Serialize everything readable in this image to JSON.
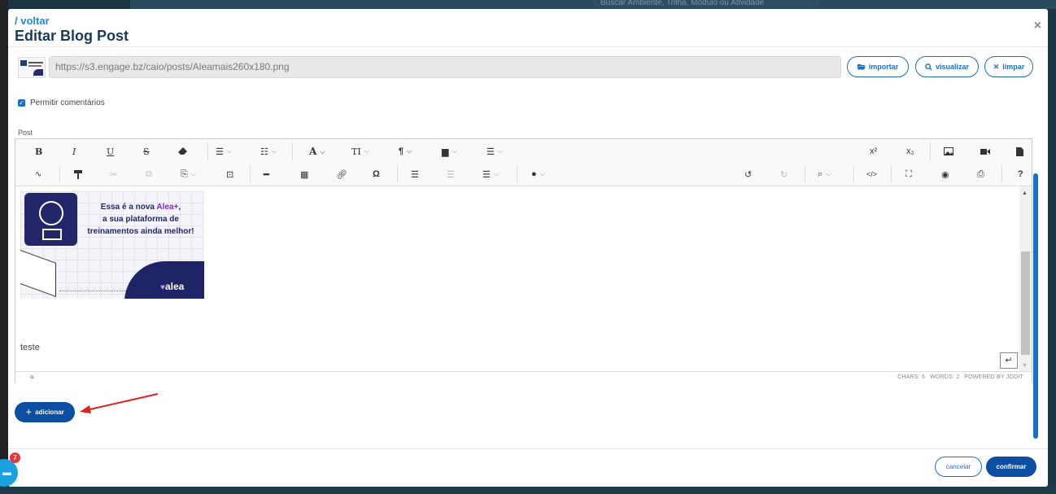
{
  "background": {
    "search_placeholder": "Buscar Ambiente, Trilha, Módulo ou Atividade"
  },
  "modal": {
    "back_link": "/ voltar",
    "title": "Editar Blog Post",
    "close_icon": "×"
  },
  "image_field": {
    "url": "https://s3.engage.bz/caio/posts/Aleamais260x180.png",
    "buttons": {
      "import": "importar",
      "preview": "visualizar",
      "clear": "limpar"
    }
  },
  "allow_comments": {
    "label": "Permitir comentários",
    "checked": true
  },
  "post_label": "Post",
  "editor": {
    "toolbar_row1": {
      "bold": "B",
      "italic": "I",
      "underline": "U",
      "strikethrough": "S",
      "font": "A",
      "font_size": "TI",
      "paragraph": "¶",
      "superscript": "x²",
      "subscript": "x₂",
      "omega": "Ω",
      "help": "?"
    },
    "banner": {
      "line1": "Essa é a nova ",
      "line1_highlight": "Alea+",
      "line1_end": ",",
      "line2": "a sua plataforma de",
      "line3": "treinamentos ainda melhor!",
      "brand": "alea"
    },
    "content_text": "teste",
    "status": {
      "chars": "CHARS: 6",
      "words": "WORDS: 2",
      "powered": "POWERED BY JODIT"
    }
  },
  "add_button": "adicionar",
  "footer": {
    "cancel": "cancelar",
    "confirm": "confirmar"
  },
  "chat": {
    "badge": "7"
  },
  "colors": {
    "primary": "#0b4ea2",
    "link": "#1e88e5",
    "title": "#1a3a5c",
    "arrow": "#e02020"
  }
}
